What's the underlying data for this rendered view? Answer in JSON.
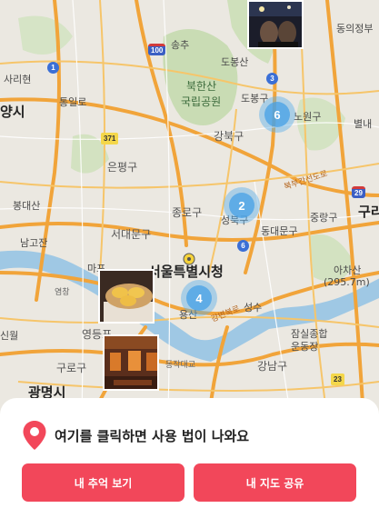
{
  "map": {
    "labels": {
      "songchu": "송추",
      "dongducheon_area": "동의정부",
      "saribyeon": "사리현",
      "dobongsan": "도봉산",
      "bukhansan": "북한산",
      "national_park": "국립공원",
      "dobonggu": "도봉구",
      "tonggilro": "통일로",
      "goyang_si": "양시",
      "nowongu": "노원구",
      "gangbukgu": "강북구",
      "byeolnae": "별내",
      "eunpyeonggu": "은평구",
      "bukbu_expressway": "북부간선도로",
      "jongnogu": "종로구",
      "seongbukgu": "성북구",
      "jungnanggu": "중랑구",
      "gu_edge": "구리",
      "bongdaesan": "봉대산",
      "seodaemungu": "서대문구",
      "dongdaemungu": "동대문구",
      "namgojan": "남고잔",
      "seoul_city_hall": "서울특별시청",
      "mapo": "마포",
      "achasan": "아차산",
      "achasan_height": "(295.7m)",
      "yeomchang": "염창",
      "yongsangu": "용산",
      "seongsu": "성수",
      "sinwol": "신월",
      "yeongdeungpo": "영등포",
      "jamsil_stadium": "잠실종합",
      "stadium": "운동장",
      "gurogu": "구로구",
      "dongjak_bridge": "동작대교",
      "gangnamgu": "강남구",
      "gwangmyeong": "광명시",
      "gangbyeon_road": "강변북로"
    },
    "shields": {
      "r1": "1",
      "r100": "100",
      "r3": "3",
      "r371": "371",
      "r29": "29",
      "r6": "6",
      "r23": "23"
    },
    "clusters": [
      {
        "count": "6"
      },
      {
        "count": "2"
      },
      {
        "count": "4"
      }
    ]
  },
  "sheet": {
    "hint": "여기를 클릭하면 사용 법이 나와요",
    "primary_button": "내 추억 보기",
    "secondary_button": "내 지도 공유",
    "accent": "#f2475a"
  }
}
